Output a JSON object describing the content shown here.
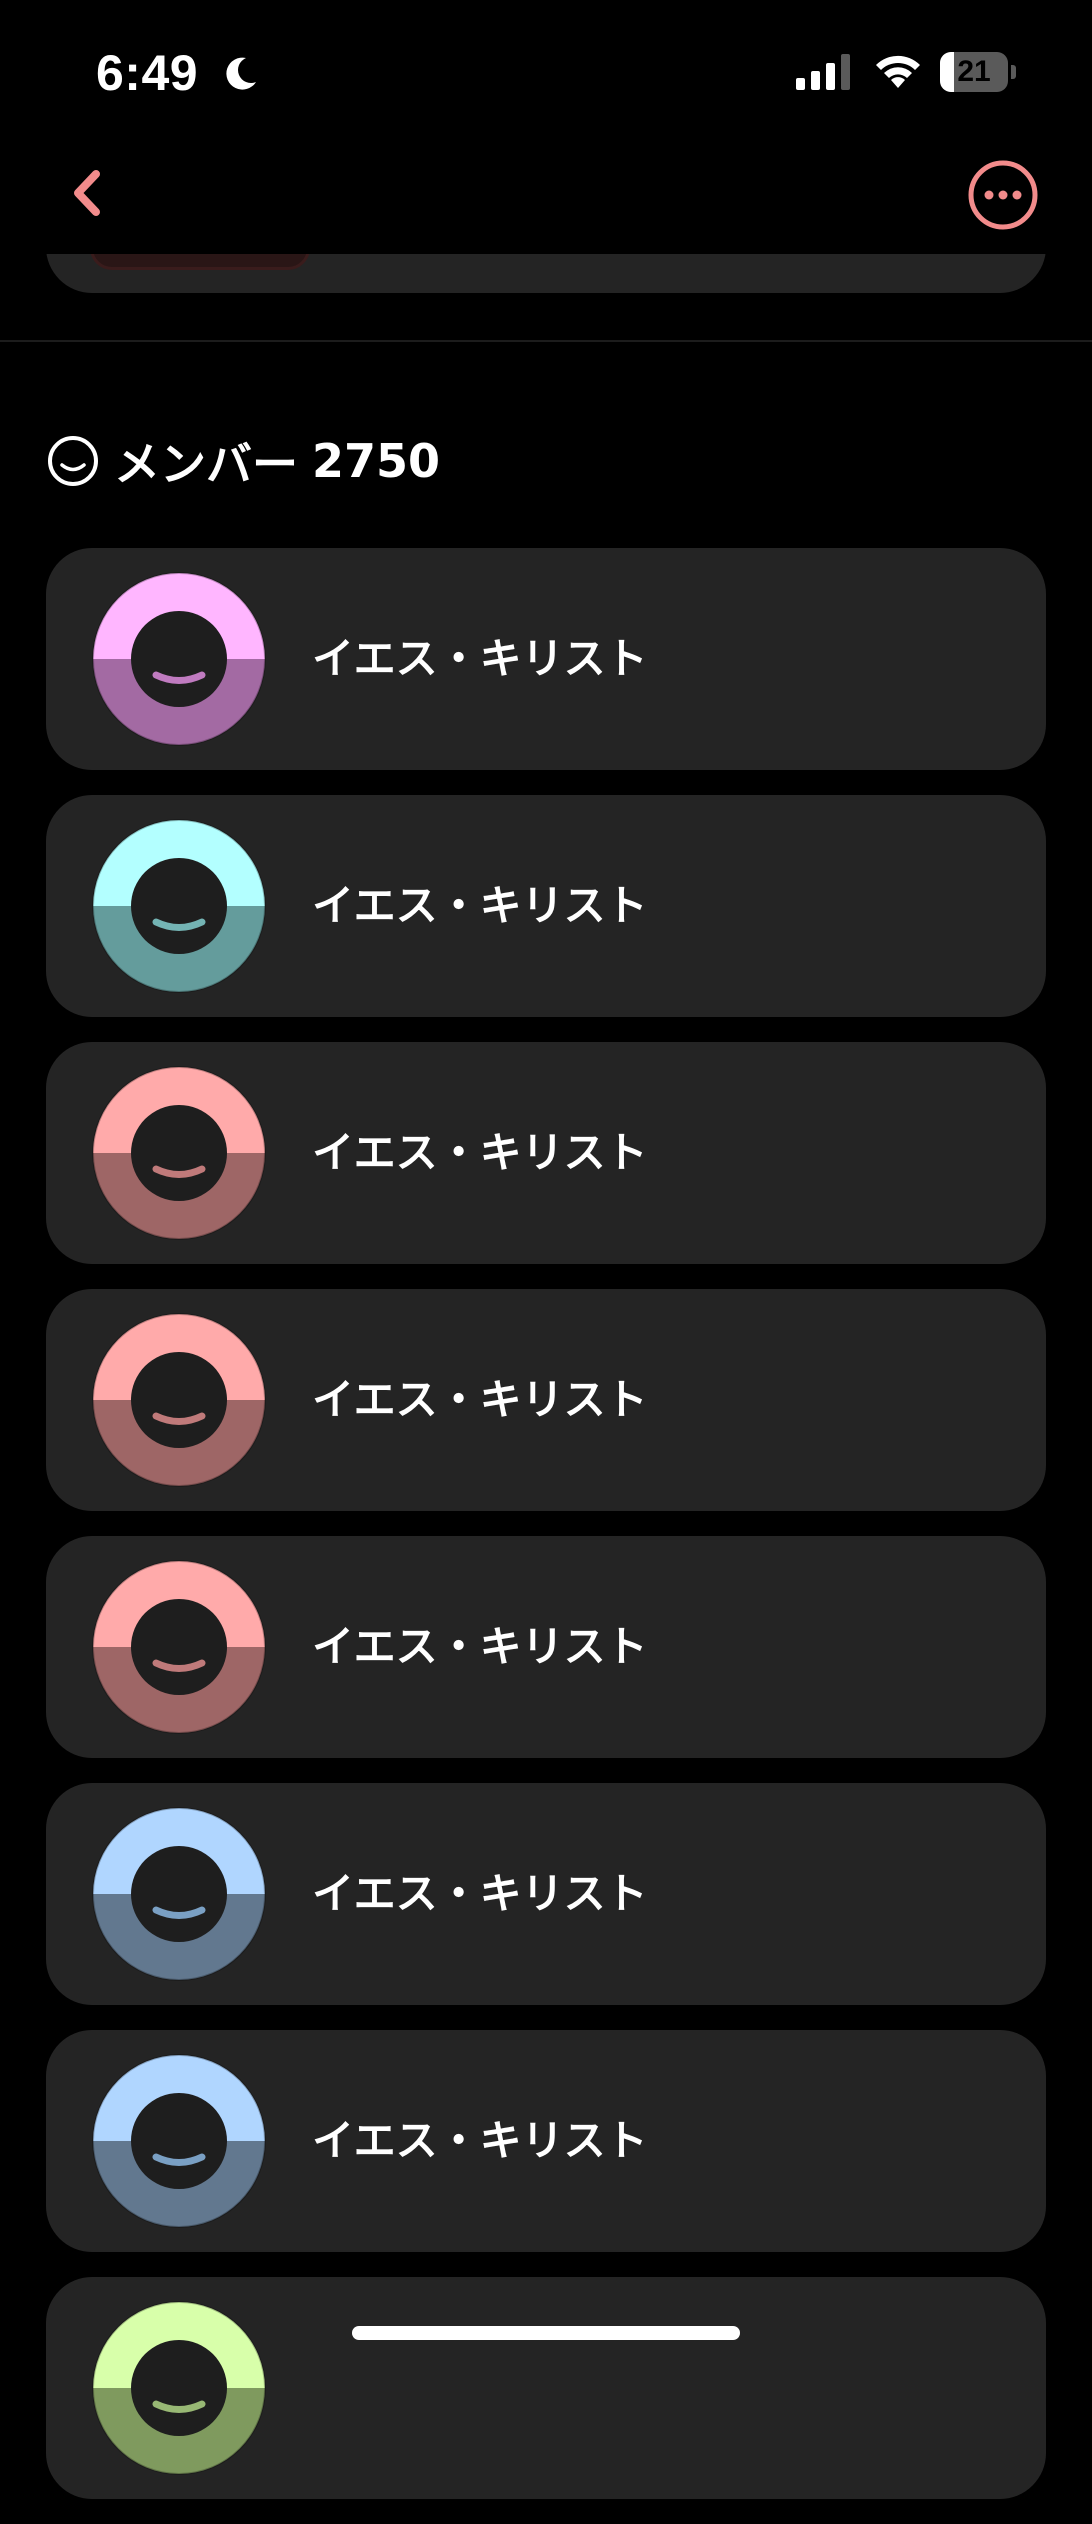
{
  "status_bar": {
    "time": "6:49",
    "battery_level": "21",
    "battery_fraction": 0.21,
    "icons": [
      "moon-icon",
      "cellular-signal-icon",
      "wifi-icon",
      "battery-icon"
    ]
  },
  "nav": {
    "back_icon": "chevron-left-icon",
    "more_icon": "ellipsis-circle-icon",
    "accent_color": "#f28b8b"
  },
  "members_section": {
    "icon": "smile-face-icon",
    "label": "メンバー",
    "count": "2750",
    "members": [
      {
        "name": "イエス・キリスト",
        "avatar_top": "#ffb6ff",
        "avatar_bottom": "#a36aa3",
        "smile": "#c07bc0"
      },
      {
        "name": "イエス・キリスト",
        "avatar_top": "#b3ffff",
        "avatar_bottom": "#649c9c",
        "smile": "#74b4b4"
      },
      {
        "name": "イエス・キリスト",
        "avatar_top": "#ffaaaa",
        "avatar_bottom": "#9e6666",
        "smile": "#c07a7a"
      },
      {
        "name": "イエス・キリスト",
        "avatar_top": "#ffaaaa",
        "avatar_bottom": "#9e6666",
        "smile": "#c07a7a"
      },
      {
        "name": "イエス・キリスト",
        "avatar_top": "#ffaaaa",
        "avatar_bottom": "#9e6666",
        "smile": "#c07a7a"
      },
      {
        "name": "イエス・キリスト",
        "avatar_top": "#b0d6ff",
        "avatar_bottom": "#62788f",
        "smile": "#7aa0c4"
      },
      {
        "name": "イエス・キリスト",
        "avatar_top": "#b0d6ff",
        "avatar_bottom": "#62788f",
        "smile": "#7aa0c4"
      },
      {
        "name": "",
        "avatar_top": "#d8ffaa",
        "avatar_bottom": "#7f9a5e",
        "smile": "#98b874"
      }
    ]
  },
  "colors": {
    "background": "#000000",
    "card": "#242424",
    "text": "#ffffff"
  }
}
